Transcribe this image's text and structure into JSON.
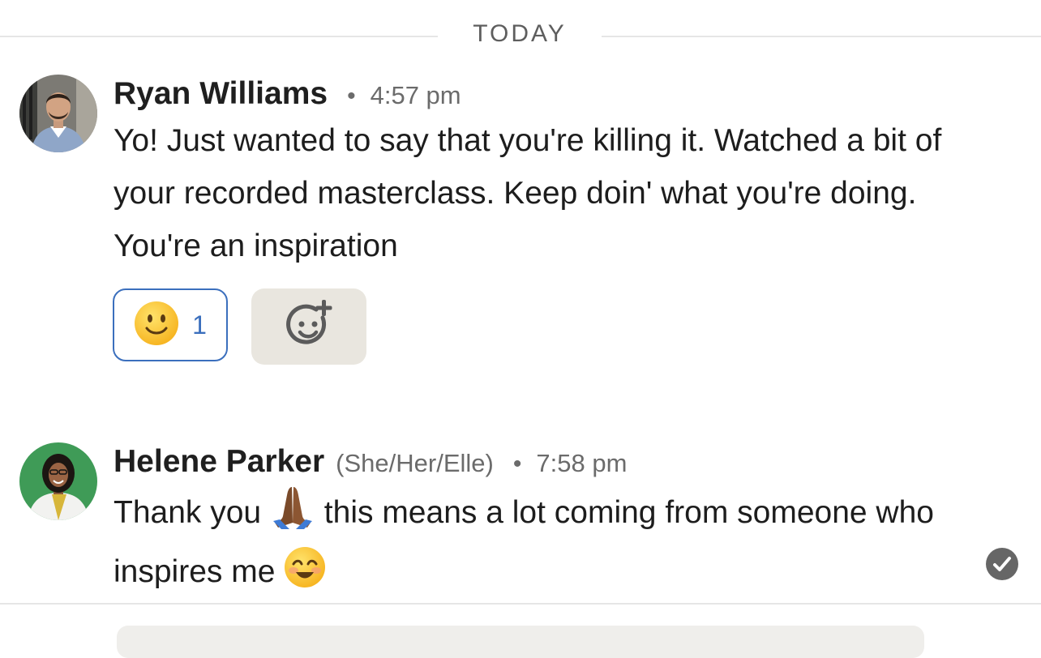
{
  "date_divider": "TODAY",
  "messages": [
    {
      "author": "Ryan Williams",
      "separator": "•",
      "time": "4:57 pm",
      "text": "Yo! Just wanted to say that you're killing it. Watched a bit of your recorded masterclass. Keep doin' what you're doing. You're an inspiration",
      "reaction": {
        "emoji": "slightly-smiling-face",
        "count": "1"
      },
      "add_reaction_icon": "add-emoji-icon"
    },
    {
      "author": "Helene Parker",
      "pronouns": "(She/Her/Elle)",
      "separator": "•",
      "time": "7:58 pm",
      "text_part1": "Thank you",
      "text_part2": "this means a lot coming from someone who inspires me",
      "inline_emojis": [
        "folded-hands",
        "smiling-face-with-smiling-eyes"
      ],
      "status_icon": "seen-check-icon"
    }
  ],
  "colors": {
    "accent_blue": "#3b6fbd",
    "muted_text": "#6b6b6b",
    "add_reaction_bg": "#e9e6df"
  }
}
